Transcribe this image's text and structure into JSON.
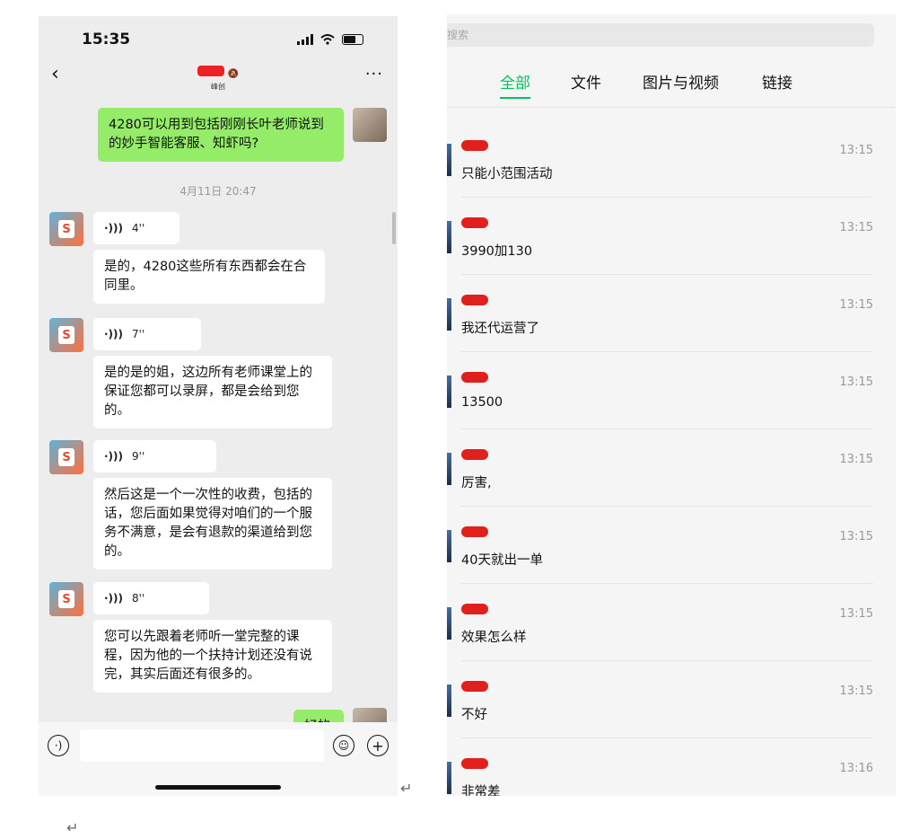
{
  "phone": {
    "status_time": "15:35",
    "chat_title_sub": "峰创",
    "back_glyph": "‹",
    "more_glyph": "···",
    "messages": [
      {
        "type": "text",
        "side": "right",
        "text": "4280可以用到包括刚刚长叶老师说到的妙手智能客服、知虾吗?"
      },
      {
        "type": "timestamp",
        "text": "4月11日 20:47"
      },
      {
        "type": "voice",
        "side": "left",
        "duration": "4''"
      },
      {
        "type": "text",
        "side": "left",
        "text": "是的，4280这些所有东西都会在合同里。"
      },
      {
        "type": "voice",
        "side": "left",
        "duration": "7''"
      },
      {
        "type": "text",
        "side": "left",
        "text": "是的是的姐，这边所有老师课堂上的保证您都可以录屏，都是会给到您的。"
      },
      {
        "type": "voice",
        "side": "left",
        "duration": "9''"
      },
      {
        "type": "text",
        "side": "left",
        "text": "然后这是一个一次性的收费，包括的话，您后面如果觉得对咱们的一个服务不满意，是会有退款的渠道给到您的。"
      },
      {
        "type": "voice",
        "side": "left",
        "duration": "8''"
      },
      {
        "type": "text",
        "side": "left",
        "text": "您可以先跟着老师听一堂完整的课程，因为他的一个扶持计划还没有说完，其实后面还有很多的。"
      },
      {
        "type": "text",
        "side": "right",
        "text": "好的"
      }
    ]
  },
  "panel": {
    "search_placeholder": "搜索",
    "tabs": [
      "全部",
      "文件",
      "图片与视频",
      "链接"
    ],
    "active_tab": 0,
    "rows": [
      {
        "msg": "只能小范围活动",
        "time": "13:15"
      },
      {
        "msg": "3990加130",
        "time": "13:15"
      },
      {
        "msg": "我还代运营了",
        "time": "13:15"
      },
      {
        "msg": "13500",
        "time": "13:15"
      },
      {
        "msg": "厉害,",
        "time": "13:15"
      },
      {
        "msg": "40天就出一单",
        "time": "13:15"
      },
      {
        "msg": "效果怎么样",
        "time": "13:15"
      },
      {
        "msg": "不好",
        "time": "13:15"
      },
      {
        "msg": "非常差",
        "time": "13:16"
      }
    ]
  },
  "colors": {
    "wechat_green": "#07c160",
    "bubble_green": "#95ec69",
    "redaction": "#e0201c"
  },
  "icons": [
    "voice-input-icon",
    "emoji-icon",
    "add-icon",
    "back-icon",
    "more-icon",
    "wifi-icon",
    "battery-icon",
    "signal-icon",
    "mute-icon"
  ]
}
